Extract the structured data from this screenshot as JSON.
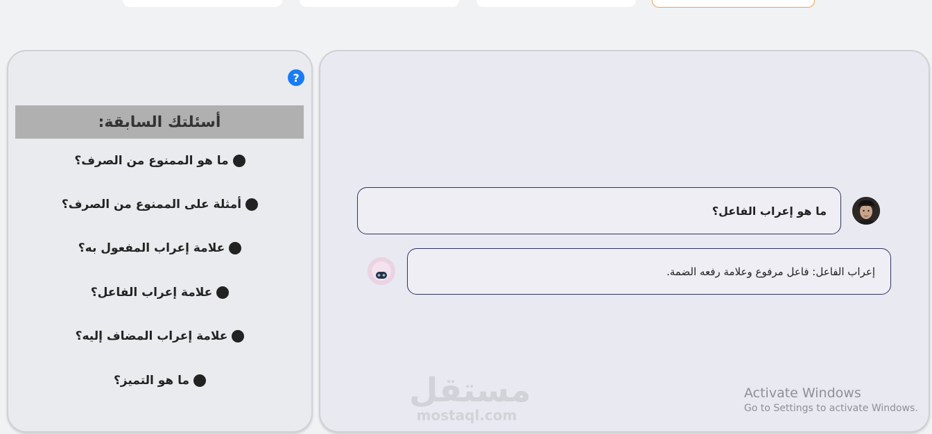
{
  "colors": {
    "help_icon": "#1a7cf5",
    "active_tab_border": "#e8a25a",
    "bubble_border": "#2f3160",
    "history_header_bg": "#b0b0b0"
  },
  "sidebar": {
    "help_icon_glyph": "?",
    "history_title": "أسئلتك السابقة:",
    "items": [
      {
        "label": "ما هو الممنوع من الصرف؟"
      },
      {
        "label": "أمثلة على الممنوع من الصرف؟"
      },
      {
        "label": "علامة إعراب المفعول به؟"
      },
      {
        "label": "علامة إعراب الفاعل؟"
      },
      {
        "label": "علامة إعراب المضاف إليه؟"
      },
      {
        "label": "ما هو التميز؟"
      }
    ]
  },
  "chat": {
    "messages": [
      {
        "role": "user",
        "text": "ما هو إعراب الفاعل؟"
      },
      {
        "role": "bot",
        "text": "إعراب الفاعل: فاعل مرفوع وعلامة رفعه الضمة."
      }
    ]
  },
  "watermark": {
    "arabic": "مستقل",
    "latin": "mostaql.com"
  },
  "os_overlay": {
    "title": "Activate Windows",
    "subtitle": "Go to Settings to activate Windows."
  }
}
